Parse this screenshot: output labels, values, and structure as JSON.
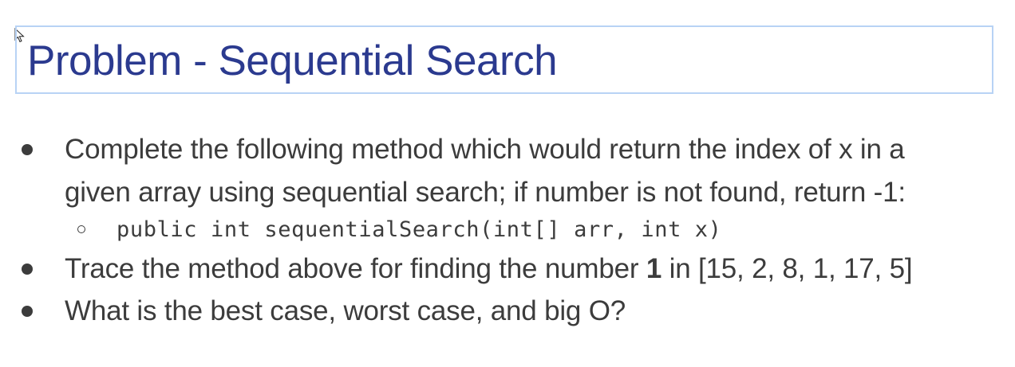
{
  "slide": {
    "title": "Problem - Sequential Search",
    "bullets": [
      {
        "line1": "Complete the following method which would return the index of x in a",
        "line2": "given array using sequential search; if number is not found, return -1:"
      },
      {
        "prefix": "Trace the method above for finding the number ",
        "bold": "1",
        "suffix": " in [15, 2, 8, 1, 17, 5]"
      },
      {
        "text": "What is the best case, worst case, and big O?"
      }
    ],
    "sub_bullet_code": "public int sequentialSearch(int[] arr, int x)"
  },
  "colors": {
    "title": "#2b3a8f",
    "body_text": "#3c3c3c",
    "title_border": "#b8d3f5"
  },
  "icons": {
    "cursor": "mouse-pointer-icon"
  }
}
